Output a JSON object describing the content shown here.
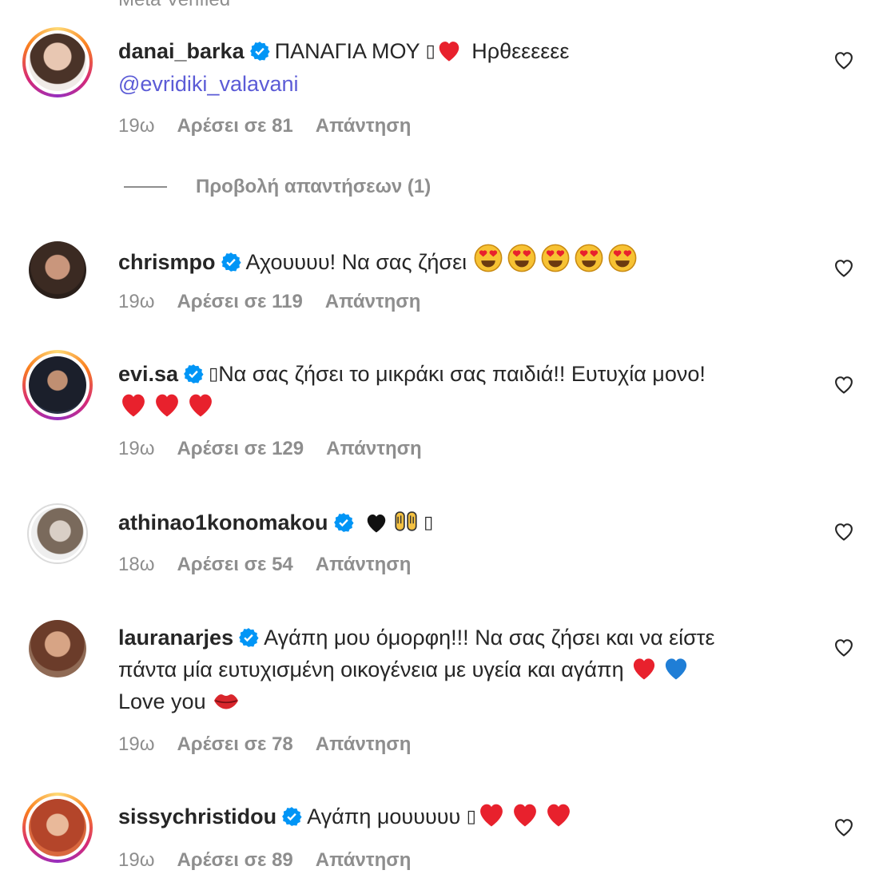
{
  "top_cut_text": "Meta Verified",
  "view_replies_label": "Προβολή απαντήσεων (1)",
  "colors": {
    "heart": "#e8212d",
    "blue_heart": "#1f7ed6",
    "verified": "#0095f6",
    "mention": "#5b5bd6"
  },
  "comments": [
    {
      "username": "danai_barka",
      "text_before": "ΠΑΝΑΓΙΑ ΜΟΥ ",
      "text_after": " Ηρθεεεεεε",
      "mention": "@evridiki_valavani",
      "time": "19ω",
      "likes": "Αρέσει σε 81",
      "reply": "Απάντηση"
    },
    {
      "username": "chrismpo",
      "text": "Αχουυυυ! Να σας ζήσει",
      "time": "19ω",
      "likes": "Αρέσει σε 119",
      "reply": "Απάντηση"
    },
    {
      "username": "evi.sa",
      "text": "Να σας ζήσει το μικράκι σας παιδιά!! Ευτυχία μονο!",
      "time": "19ω",
      "likes": "Αρέσει σε 129",
      "reply": "Απάντηση"
    },
    {
      "username": "athinao1konomakou",
      "time": "18ω",
      "likes": "Αρέσει σε 54",
      "reply": "Απάντηση"
    },
    {
      "username": "lauranarjes",
      "text_line1": "Αγάπη μου όμορφη!!! Να σας ζήσει και να είστε",
      "text_line2": "πάντα μία ευτυχισμένη οικογένεια με υγεία και αγάπη",
      "text_line3": "Love you",
      "time": "19ω",
      "likes": "Αρέσει σε 78",
      "reply": "Απάντηση"
    },
    {
      "username": "sissychristidou",
      "text": "Αγάπη μουυυυυ",
      "time": "19ω",
      "likes": "Αρέσει σε 89",
      "reply": "Απάντηση"
    }
  ]
}
